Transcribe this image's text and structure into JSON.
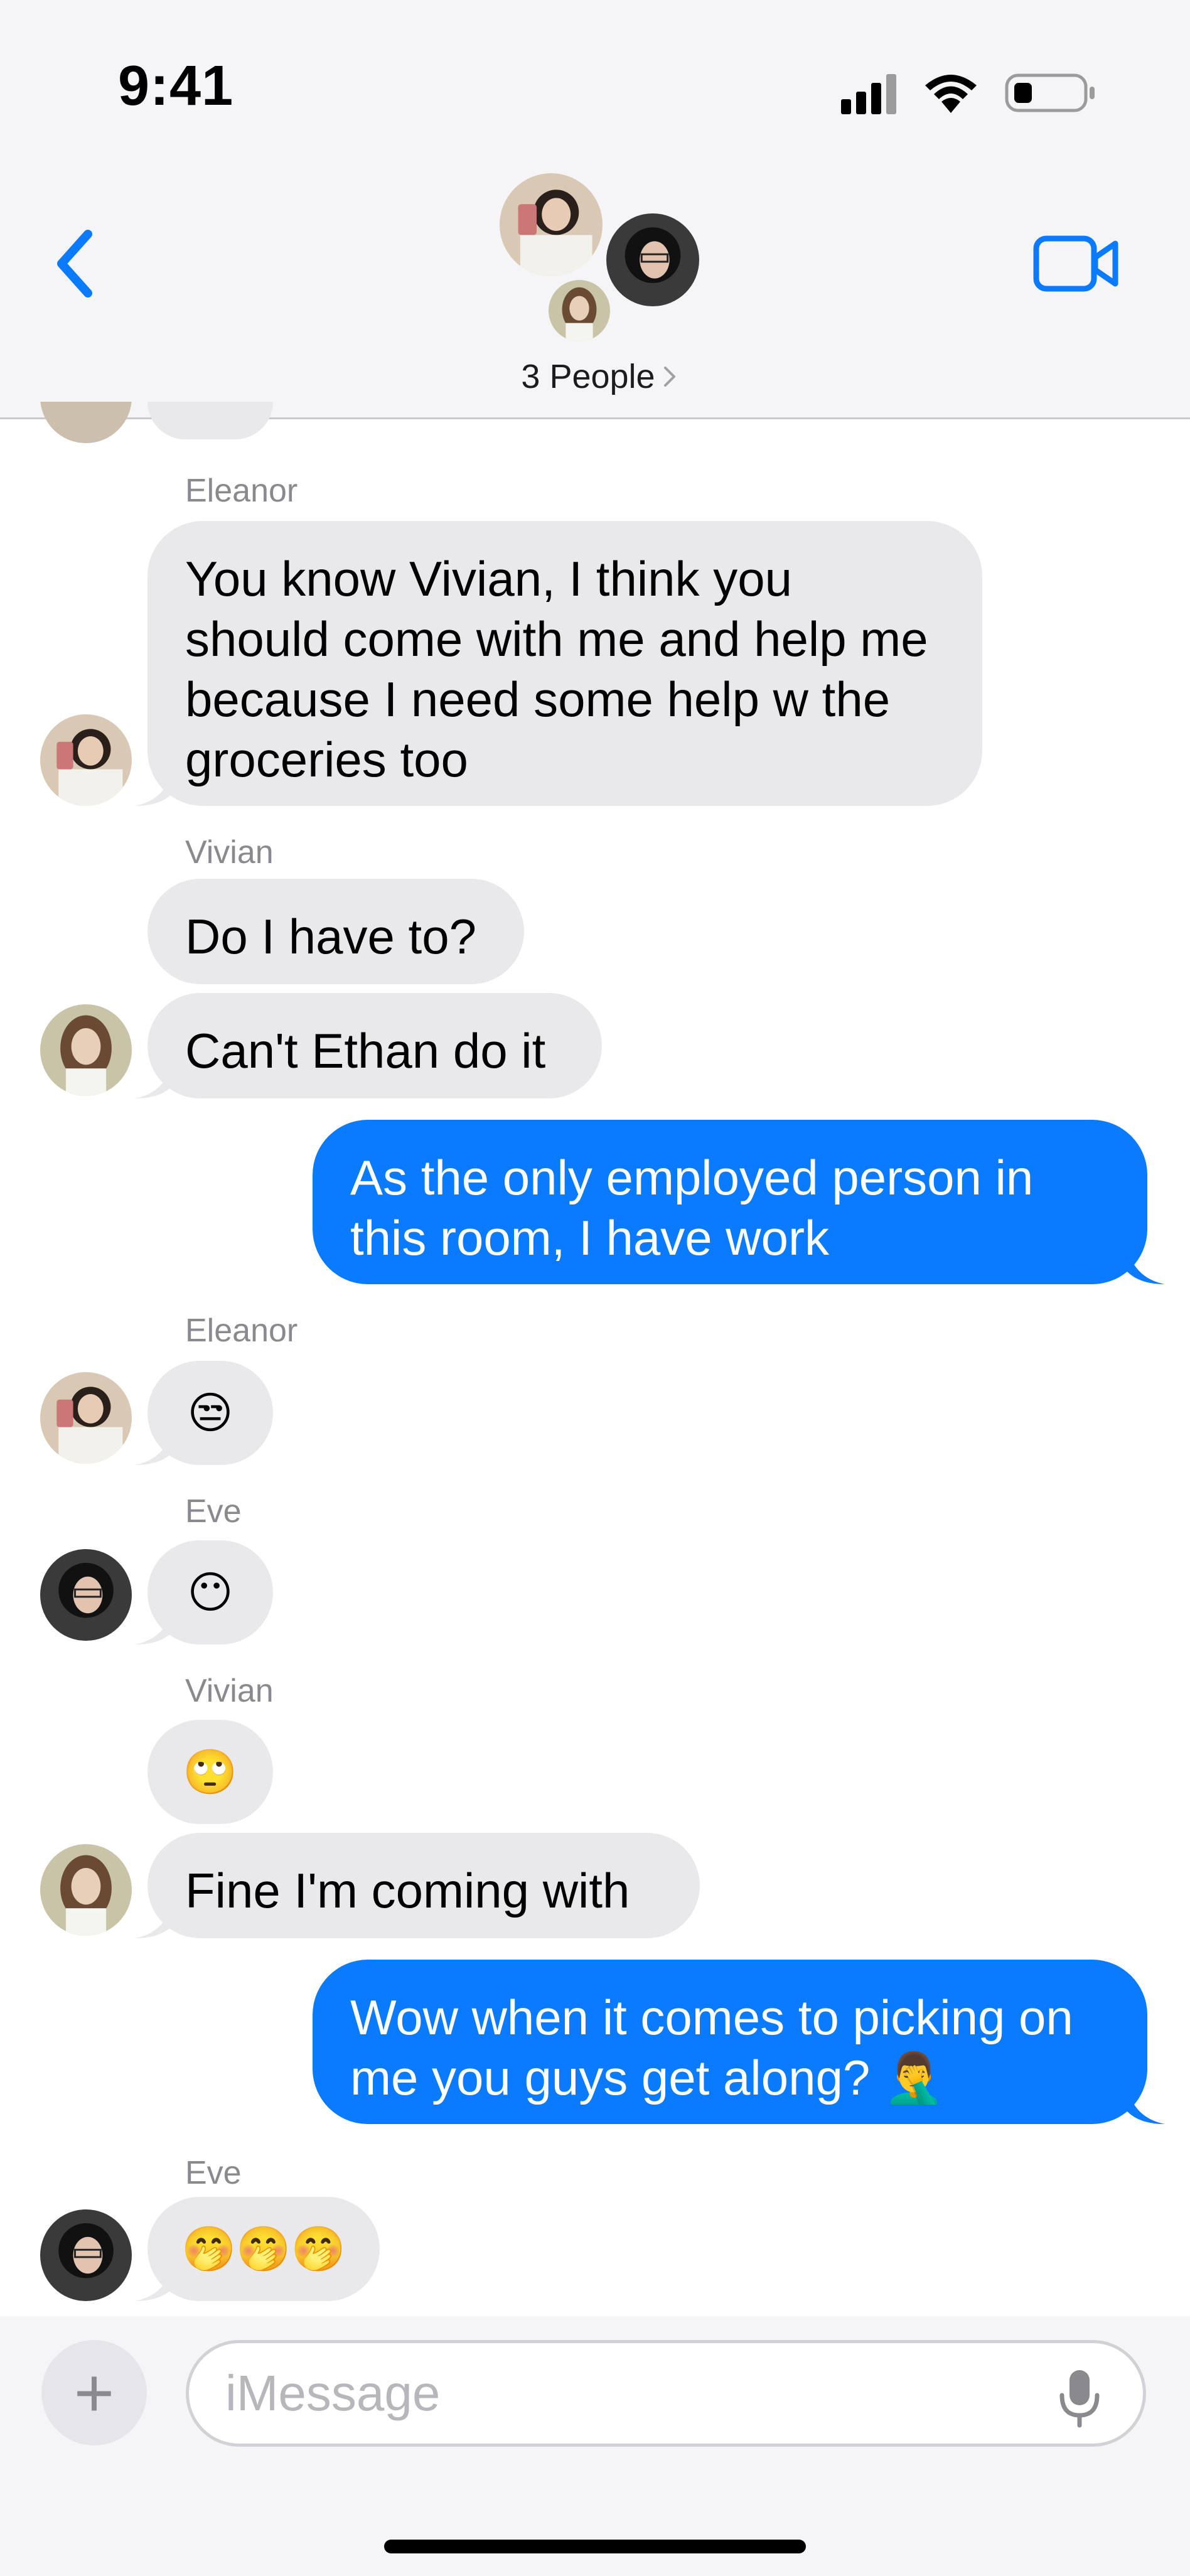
{
  "status_bar": {
    "time": "9:41"
  },
  "header": {
    "people_label": "3 People"
  },
  "messages": [
    {
      "sender": "Eleanor",
      "text": "You know Vivian, I think you should come with me and help me because I need some help w the groceries too"
    },
    {
      "sender": "Vivian",
      "text": "Do I have to?"
    },
    {
      "text": "Can't Ethan do it"
    },
    {
      "text": "As the only employed person in this room, I have work"
    },
    {
      "sender": "Eleanor",
      "text": "😒"
    },
    {
      "sender": "Eve",
      "text": "😶"
    },
    {
      "sender": "Vivian",
      "text": "🙄"
    },
    {
      "text": "Fine I'm coming with"
    },
    {
      "text": "Wow when it comes to picking on me you guys get along? 🤦‍♂️"
    },
    {
      "sender": "Eve",
      "text": "🤭🤭🤭"
    }
  ],
  "composer": {
    "placeholder": "iMessage"
  },
  "colors": {
    "accent": "#0a7bff",
    "incoming_bubble": "#e9e9eb"
  },
  "icons": [
    "back-chevron-icon",
    "video-camera-icon",
    "plus-icon",
    "microphone-icon",
    "signal-icon",
    "wifi-icon",
    "battery-icon"
  ]
}
